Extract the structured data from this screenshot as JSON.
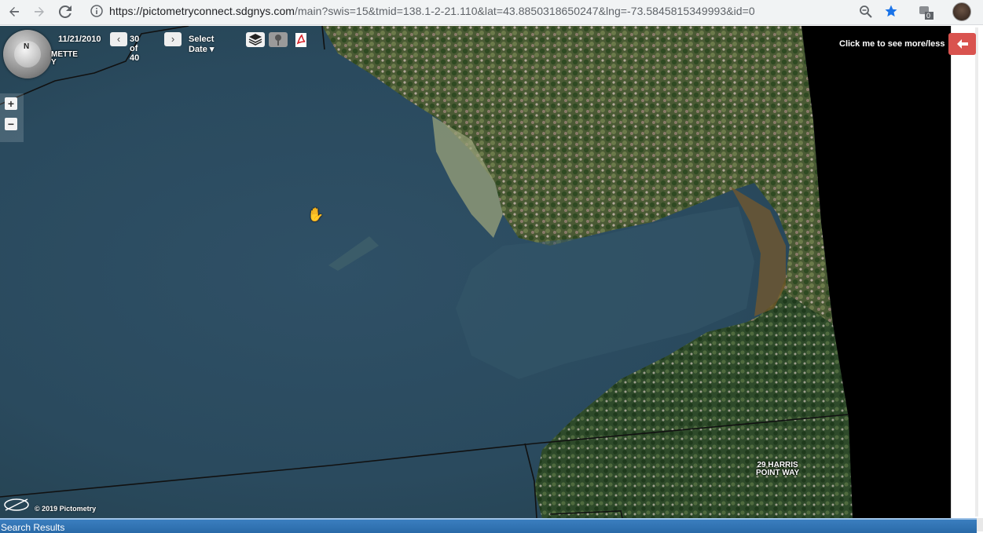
{
  "browser": {
    "url_host": "https://pictometryconnect.sdgnys.com",
    "url_path": "/main?swis=15&tmid=138.1-2-21.110&lat=43.8850318650247&lng=-73.5845815349993&id=0",
    "extension_badge": "0",
    "icons": [
      "back-icon",
      "forward-icon",
      "reload-icon",
      "info-icon",
      "zoom-icon",
      "star-icon",
      "extension-icon",
      "profile-avatar"
    ]
  },
  "toolbar": {
    "date": "11/21/2010",
    "prev_label": "‹",
    "page": "30 of 40",
    "next_label": "›",
    "select_date": "Select Date ▾",
    "icons": [
      "layers-icon",
      "pin-icon",
      "pdf-icon"
    ]
  },
  "compass": {
    "north": "N"
  },
  "zoom": {
    "in": "+",
    "out": "−"
  },
  "map_labels": {
    "top_left": "METTE\nY",
    "parcel": "29 HARRIS\nPOINT WAY"
  },
  "copyright": "© 2019 Pictometry",
  "info_panel": {
    "toggle": "Click me to see more/less",
    "collapse_icon": "arrow-left-icon"
  },
  "search_results": {
    "label": "Search Results"
  },
  "colors": {
    "water": "#2d4b5f",
    "forest": "#3f5a2a",
    "accent_red": "#d9534f",
    "bar_blue": "#2f72b3"
  }
}
